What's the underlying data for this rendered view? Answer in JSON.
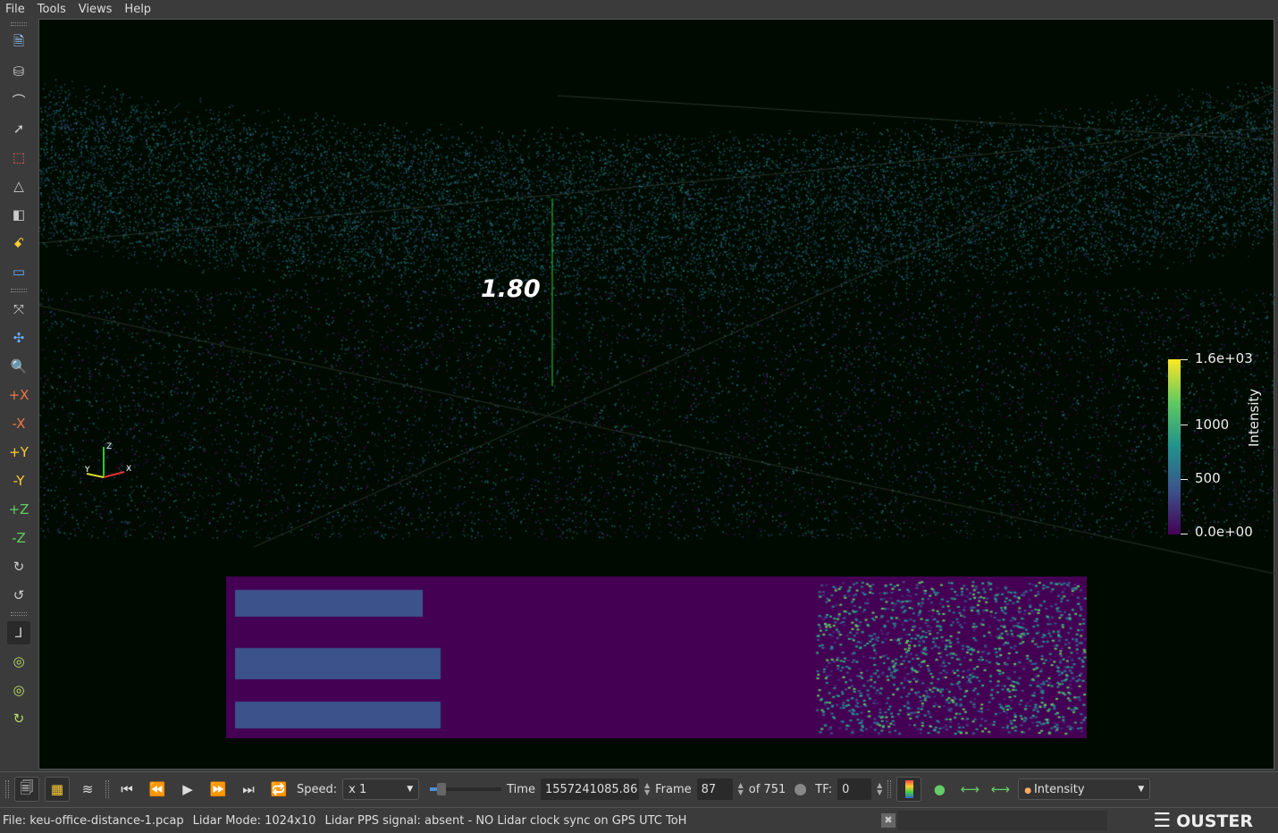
{
  "menu": [
    "File",
    "Tools",
    "Views",
    "Help"
  ],
  "viewport": {
    "measurement_label": "1.80",
    "axes": {
      "x": "X",
      "y": "Y",
      "z": "Z"
    }
  },
  "colorbar": {
    "title": "Intensity",
    "labels": [
      "1.6e+03",
      "1000",
      "500",
      "0.0e+00"
    ],
    "colors": [
      "#440154",
      "#3b528b",
      "#21918c",
      "#5ec962",
      "#fde725"
    ]
  },
  "toolbar": {
    "speed_label": "Speed:",
    "speed_value": "x 1",
    "time_label": "Time",
    "time_value": "1557241085.86",
    "frame_label": "Frame",
    "frame_value": "87",
    "of_label": "of 751",
    "tf_label": "TF:",
    "tf_value": "0",
    "array_value": "Intensity"
  },
  "status": {
    "file": "File: keu-office-distance-1.pcap",
    "mode": "Lidar Mode: 1024x10",
    "pps": "Lidar PPS signal: absent - NO Lidar clock sync on GPS UTC ToH",
    "brand": "OUSTER"
  }
}
